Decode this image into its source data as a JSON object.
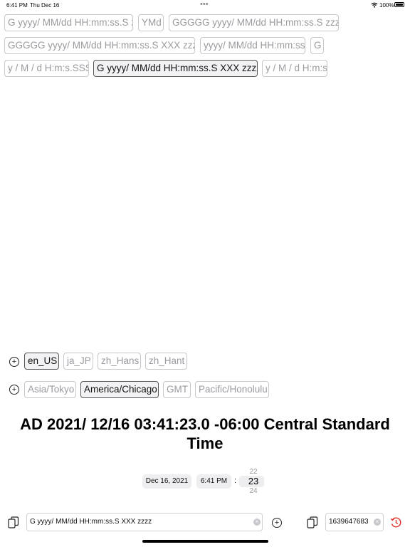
{
  "status": {
    "time": "6:41 PM",
    "date": "Thu Dec 16",
    "dots": "•••",
    "battery": "100%"
  },
  "formats": [
    "G yyyy/ MM/dd HH:mm:ss.S z",
    "YMd",
    "GGGGG yyyy/ MM/dd HH:mm:ss.S zzzz",
    "GGGGG yyyy/ MM/dd HH:mm:ss.S XXX zzzz",
    "yyyy/ MM/dd HH:mm:ss",
    "G",
    "y / M / d H:m:s.SSS",
    "G yyyy/ MM/dd HH:mm:ss.S XXX zzzz",
    "y / M / d H:m:s"
  ],
  "locales": [
    "en_US",
    "ja_JP",
    "zh_Hans",
    "zh_Hant"
  ],
  "timezones": [
    "Asia/Tokyo",
    "America/Chicago",
    "GMT",
    "Pacific/Honolulu"
  ],
  "icons": {
    "plus": "plus-circle-icon",
    "copy": "copy-icon",
    "clear": "clear-icon",
    "reset": "history-icon"
  },
  "result": "AD 2021/ 12/16 03:41:23.0 -06:00 Central Standard Time",
  "picker": {
    "date": "Dec 16, 2021",
    "time": "6:41 PM",
    "colon": ":",
    "sec_prev": "22",
    "sec": "23",
    "sec_next": "24"
  },
  "format_input": {
    "value": "G yyyy/ MM/dd HH:mm:ss.S XXX zzzz"
  },
  "timestamp_input": {
    "value": "1639647683"
  },
  "colors": {
    "accent": "#e0312a",
    "selected_border": "#555555",
    "chip_border": "#c7c7cc"
  }
}
